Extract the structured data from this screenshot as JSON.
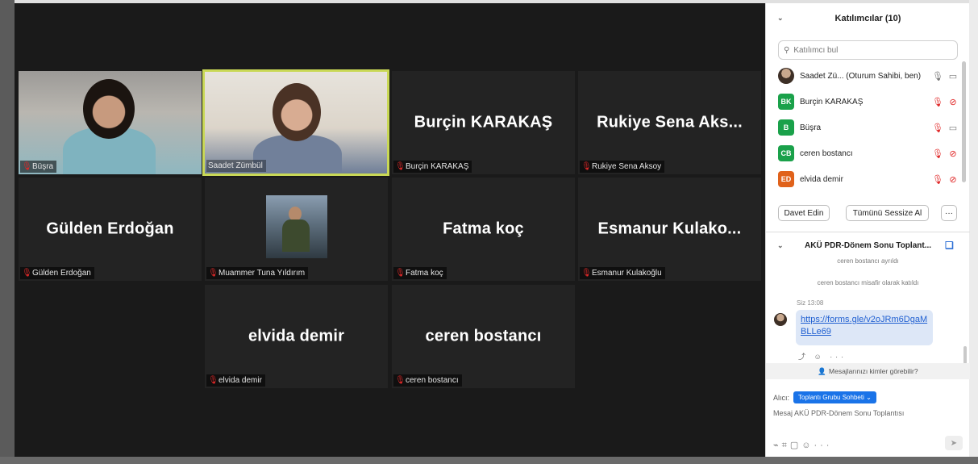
{
  "tiles": [
    {
      "id": "busra",
      "label": "Büşra",
      "big_name": ""
    },
    {
      "id": "saadet",
      "label": "Saadet Zümbül",
      "big_name": ""
    },
    {
      "id": "burcin",
      "label": "Burçin KARAKAŞ",
      "big_name": "Burçin KARAKAŞ"
    },
    {
      "id": "rukiye",
      "label": "Rukiye Sena Aksoy",
      "big_name": "Rukiye Sena Aks..."
    },
    {
      "id": "gulden",
      "label": "Gülden Erdoğan",
      "big_name": "Gülden Erdoğan"
    },
    {
      "id": "muammer",
      "label": "Muammer Tuna Yıldırım",
      "big_name": ""
    },
    {
      "id": "fatma",
      "label": "Fatma koç",
      "big_name": "Fatma koç"
    },
    {
      "id": "esmanur",
      "label": "Esmanur Kulakoğlu",
      "big_name": "Esmanur  Kulako..."
    },
    {
      "id": "elvida",
      "label": "elvida demir",
      "big_name": "elvida demir"
    },
    {
      "id": "ceren",
      "label": "ceren bostancı",
      "big_name": "ceren bostancı"
    }
  ],
  "participants_panel": {
    "title": "Katılımcılar (10)",
    "search_placeholder": "Katılımcı bul",
    "participants": [
      {
        "initials": "",
        "name": "Saadet Zü...  (Oturum Sahibi, ben)",
        "avatar_color": "",
        "mic": "on",
        "video": "on"
      },
      {
        "initials": "BK",
        "name": "Burçin KARAKAŞ",
        "avatar_color": "#1aa14a",
        "mic": "muted",
        "video": "off"
      },
      {
        "initials": "B",
        "name": "Büşra",
        "avatar_color": "#1aa14a",
        "mic": "muted",
        "video": "on"
      },
      {
        "initials": "CB",
        "name": "ceren bostancı",
        "avatar_color": "#1aa14a",
        "mic": "muted",
        "video": "off"
      },
      {
        "initials": "ED",
        "name": "elvida demir",
        "avatar_color": "#e0621b",
        "mic": "muted",
        "video": "off"
      }
    ],
    "invite_label": "Davet Edin",
    "mute_all_label": "Tümünü Sessize Al",
    "more_label": "···"
  },
  "chat": {
    "title": "AKÜ PDR-Dönem Sonu Toplant...",
    "system_partial": "ceren bostancı ayrıldı",
    "system_joined": "ceren bostancı misafir olarak katıldı",
    "message_meta": "Siz 13:08",
    "message_link": "https://forms.gle/v2oJRm6DgaMBLLe69",
    "reactions": "⤴ ☺ ···",
    "who_can_see": "Mesajlarınızı kimler görebilir?",
    "to_label": "Alıcı:",
    "to_value": "Toplantı Grubu Sohbeti",
    "composer_placeholder": "Mesaj AKÜ PDR-Dönem Sonu Toplantısı"
  },
  "colors": {
    "active_speaker": "#c9d856",
    "muted": "#e02828",
    "link": "#1f5fd1",
    "accent": "#1a73e8"
  }
}
